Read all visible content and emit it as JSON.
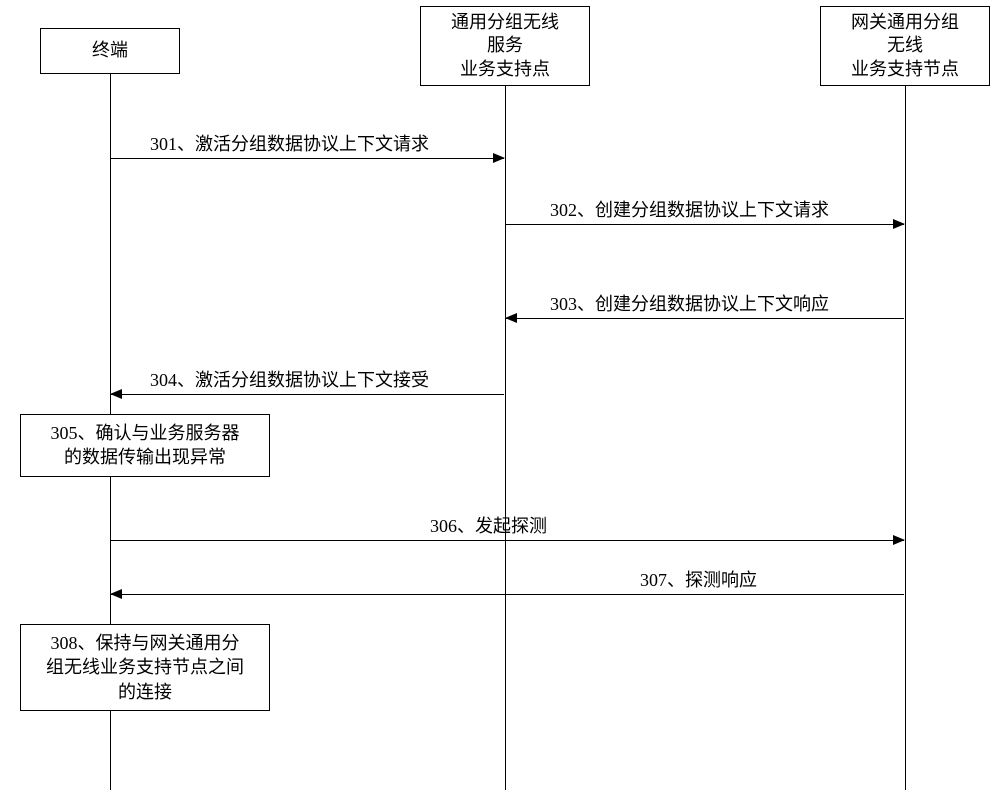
{
  "participants": {
    "terminal": "终端",
    "sgsn": "通用分组无线\n服务\n业务支持点",
    "ggsn": "网关通用分组\n无线\n业务支持节点"
  },
  "messages": {
    "m301": "301、激活分组数据协议上下文请求",
    "m302": "302、创建分组数据协议上下文请求",
    "m303": "303、创建分组数据协议上下文响应",
    "m304": "304、激活分组数据协议上下文接受",
    "m306": "306、发起探测",
    "m307": "307、探测响应"
  },
  "boxes": {
    "b305": "305、确认与业务服务器\n的数据传输出现异常",
    "b308": "308、保持与网关通用分\n组无线业务支持节点之间\n的连接"
  },
  "chart_data": {
    "type": "sequence-diagram",
    "participants": [
      {
        "id": "terminal",
        "label": "终端"
      },
      {
        "id": "sgsn",
        "label": "通用分组无线服务业务支持点"
      },
      {
        "id": "ggsn",
        "label": "网关通用分组无线业务支持节点"
      }
    ],
    "steps": [
      {
        "step": 301,
        "from": "terminal",
        "to": "sgsn",
        "label": "激活分组数据协议上下文请求"
      },
      {
        "step": 302,
        "from": "sgsn",
        "to": "ggsn",
        "label": "创建分组数据协议上下文请求"
      },
      {
        "step": 303,
        "from": "ggsn",
        "to": "sgsn",
        "label": "创建分组数据协议上下文响应"
      },
      {
        "step": 304,
        "from": "sgsn",
        "to": "terminal",
        "label": "激活分组数据协议上下文接受"
      },
      {
        "step": 305,
        "at": "terminal",
        "label": "确认与业务服务器的数据传输出现异常"
      },
      {
        "step": 306,
        "from": "terminal",
        "to": "ggsn",
        "label": "发起探测"
      },
      {
        "step": 307,
        "from": "ggsn",
        "to": "terminal",
        "label": "探测响应"
      },
      {
        "step": 308,
        "at": "terminal",
        "label": "保持与网关通用分组无线业务支持节点之间的连接"
      }
    ]
  }
}
